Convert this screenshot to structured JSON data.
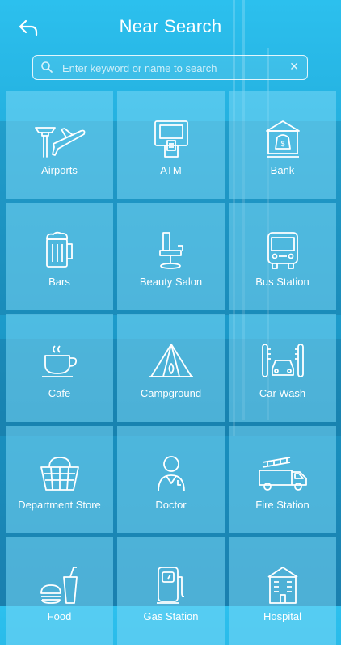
{
  "header": {
    "title": "Near Search",
    "back_icon": "back-arrow-icon"
  },
  "search": {
    "placeholder": "Enter keyword or name to search",
    "value": "",
    "clear_icon": "clear-icon"
  },
  "categories": [
    {
      "label": "Airports",
      "icon": "airport-icon"
    },
    {
      "label": "ATM",
      "icon": "atm-icon"
    },
    {
      "label": "Bank",
      "icon": "bank-icon"
    },
    {
      "label": "Bars",
      "icon": "beer-icon"
    },
    {
      "label": "Beauty Salon",
      "icon": "salon-chair-icon"
    },
    {
      "label": "Bus Station",
      "icon": "bus-icon"
    },
    {
      "label": "Cafe",
      "icon": "coffee-cup-icon"
    },
    {
      "label": "Campground",
      "icon": "tent-icon"
    },
    {
      "label": "Car Wash",
      "icon": "car-wash-icon"
    },
    {
      "label": "Department Store",
      "icon": "basket-icon"
    },
    {
      "label": "Doctor",
      "icon": "doctor-icon"
    },
    {
      "label": "Fire Station",
      "icon": "fire-truck-icon"
    },
    {
      "label": "Food",
      "icon": "food-icon"
    },
    {
      "label": "Gas Station",
      "icon": "gas-pump-icon"
    },
    {
      "label": "Hospital",
      "icon": "hospital-icon"
    }
  ],
  "colors": {
    "accent": "#2cc0ee",
    "tile": "#78d7f5",
    "text": "#ffffff"
  }
}
